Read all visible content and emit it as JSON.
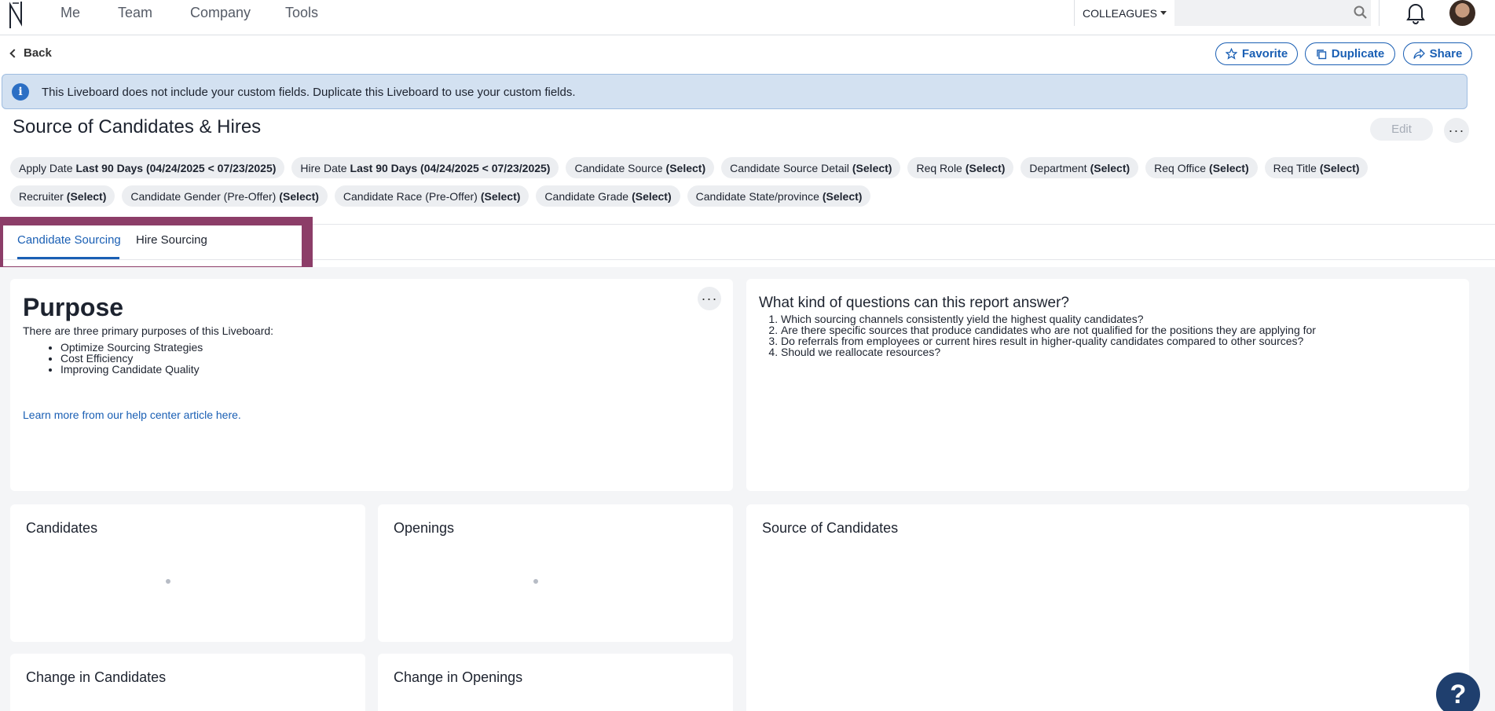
{
  "nav": {
    "items": [
      "Me",
      "Team",
      "Company",
      "Tools"
    ],
    "colleagues_label": "COLLEAGUES",
    "search_value": ""
  },
  "toolbar": {
    "back_label": "Back",
    "favorite_label": "Favorite",
    "duplicate_label": "Duplicate",
    "share_label": "Share"
  },
  "banner": {
    "text": "This Liveboard does not include your custom fields. Duplicate this Liveboard to use your custom fields."
  },
  "page": {
    "title": "Source of Candidates & Hires",
    "edit_label": "Edit"
  },
  "filters": [
    {
      "name": "Apply Date",
      "value": "Last 90 Days (04/24/2025 < 07/23/2025)"
    },
    {
      "name": "Hire Date",
      "value": "Last 90 Days (04/24/2025 < 07/23/2025)"
    },
    {
      "name": "Candidate Source",
      "value": "(Select)"
    },
    {
      "name": "Candidate Source Detail",
      "value": "(Select)"
    },
    {
      "name": "Req Role",
      "value": "(Select)"
    },
    {
      "name": "Department",
      "value": "(Select)"
    },
    {
      "name": "Req Office",
      "value": "(Select)"
    },
    {
      "name": "Req Title",
      "value": "(Select)"
    },
    {
      "name": "Recruiter",
      "value": "(Select)"
    },
    {
      "name": "Candidate Gender (Pre-Offer)",
      "value": "(Select)"
    },
    {
      "name": "Candidate Race (Pre-Offer)",
      "value": "(Select)"
    },
    {
      "name": "Candidate Grade",
      "value": "(Select)"
    },
    {
      "name": "Candidate State/province",
      "value": "(Select)"
    }
  ],
  "tabs": [
    {
      "label": "Candidate Sourcing",
      "active": true
    },
    {
      "label": "Hire Sourcing",
      "active": false
    }
  ],
  "purpose": {
    "heading": "Purpose",
    "intro": "There are three primary purposes of this Liveboard:",
    "items": [
      "Optimize Sourcing Strategies",
      "Cost Efficiency",
      "Improving Candidate Quality"
    ],
    "link": "Learn more from our help center article here."
  },
  "questions": {
    "heading": "What kind of questions can this report answer?",
    "items": [
      "Which sourcing channels consistently yield the highest quality candidates?",
      "Are there specific sources that produce candidates who are not qualified for the positions they are applying for",
      "Do referrals from employees or current hires result in higher-quality candidates compared to other sources?",
      "Should we reallocate resources?"
    ]
  },
  "cards": {
    "candidates": "Candidates",
    "openings": "Openings",
    "source_of_candidates": "Source of Candidates",
    "change_in_candidates": "Change in Candidates",
    "change_in_openings": "Change in Openings"
  },
  "help": {
    "label": "?"
  },
  "colors": {
    "accent": "#1a5fb4",
    "highlight": "#8c3d68",
    "banner_bg": "#d3e1f1"
  }
}
